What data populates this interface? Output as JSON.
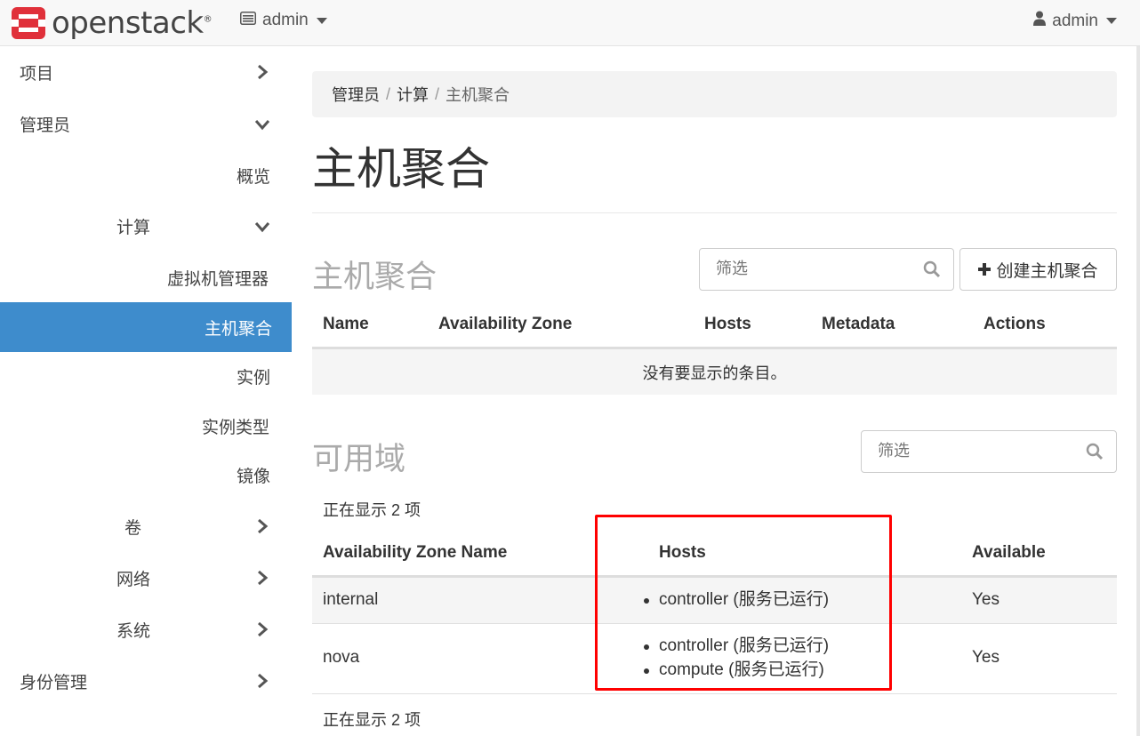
{
  "navbar": {
    "brand": "openstack",
    "brand_mark": "®",
    "project_switcher": "admin",
    "user_menu": "admin"
  },
  "sidebar": {
    "project": "项目",
    "admin": "管理员",
    "overview": "概览",
    "compute": "计算",
    "hypervisors": "虚拟机管理器",
    "host_aggregates": "主机聚合",
    "instances": "实例",
    "flavors": "实例类型",
    "images": "镜像",
    "volumes": "卷",
    "network": "网络",
    "system": "系统",
    "identity": "身份管理"
  },
  "breadcrumb": [
    "管理员",
    "计算",
    "主机聚合"
  ],
  "page_title": "主机聚合",
  "aggregates_section": {
    "title": "主机聚合",
    "filter_placeholder": "筛选",
    "create_button": "创建主机聚合",
    "columns": [
      "Name",
      "Availability Zone",
      "Hosts",
      "Metadata",
      "Actions"
    ],
    "empty_message": "没有要显示的条目。"
  },
  "zones_section": {
    "title": "可用域",
    "filter_placeholder": "筛选",
    "count_top": "正在显示 2 项",
    "count_bottom": "正在显示 2 项",
    "columns": [
      "Availability Zone Name",
      "Hosts",
      "Available"
    ],
    "rows": [
      {
        "name": "internal",
        "hosts": [
          "controller (服务已运行)"
        ],
        "available": "Yes"
      },
      {
        "name": "nova",
        "hosts": [
          "controller (服务已运行)",
          "compute (服务已运行)"
        ],
        "available": "Yes"
      }
    ]
  },
  "colors": {
    "active_nav": "#3e8ccc",
    "logo_red": "#e0303a",
    "highlight": "#ff0000"
  }
}
